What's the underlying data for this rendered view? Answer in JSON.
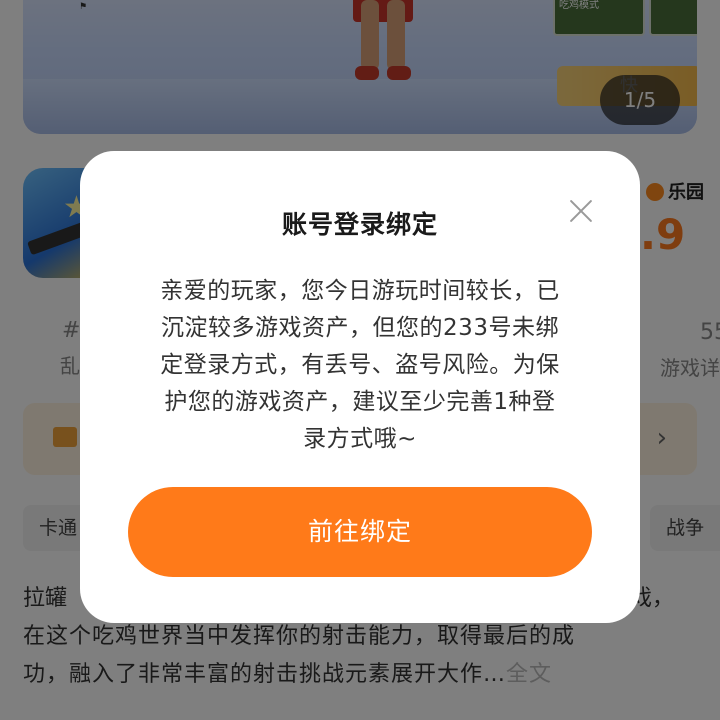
{
  "background": {
    "hero": {
      "counter": "1/5",
      "thumb_label": "吃鸡模式",
      "quick_label": "快"
    },
    "app": {
      "paradise_badge": "乐园",
      "rating_fragment": ".9",
      "stat_left_top": "#",
      "stat_left_bottom": "乱",
      "stat_right_top": "55",
      "stat_right_bottom": "游戏详"
    },
    "tags": {
      "left": "卡通",
      "right": "战争"
    },
    "description": {
      "line1_start": "拉罐",
      "line1_end": "戏，",
      "line2": "在这个吃鸡世界当中发挥你的射击能力，取得最后的成",
      "line3": "功，融入了非常丰富的射击挑战元素展开大作…",
      "more": "全文"
    }
  },
  "dialog": {
    "title": "账号登录绑定",
    "body_lines": [
      "亲爱的玩家，您今日游玩时间较长，已",
      "沉淀较多游戏资产，但您的233号未绑",
      "定登录方式，有丢号、盗号风险。为保",
      "护您的游戏资产，建议至少完善1种登",
      "录方式哦~"
    ],
    "button_label": "前往绑定",
    "colors": {
      "accent": "#ff7a19",
      "mask": "rgba(0,0,0,0.5)"
    }
  }
}
